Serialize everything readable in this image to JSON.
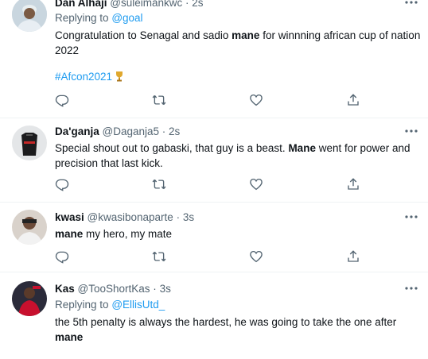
{
  "tweets": [
    {
      "name": "Dan Alhaji",
      "handle": "@suleimankwc",
      "sep": "·",
      "time": "2s",
      "reply_prefix": "Replying to",
      "reply_to": "@goal",
      "text_before": "Congratulation  to Senagal and sadio ",
      "keyword": "mane",
      "text_after": " for winnning african cup of nation 2022",
      "hashtag": "#Afcon2021",
      "emoji": "🏆"
    },
    {
      "name": "Da'ganja",
      "handle": "@Daganja5",
      "sep": "·",
      "time": "2s",
      "text_before": "Special shout out to gabaski, that guy is a beast. ",
      "keyword": "Mane",
      "text_after": " went for power and precision that last kick."
    },
    {
      "name": "kwasi",
      "handle": "@kwasibonaparte",
      "sep": "·",
      "time": "3s",
      "keyword": "mane",
      "text_after": " my hero, my mate"
    },
    {
      "name": "Kas",
      "handle": "@TooShortKas",
      "sep": "·",
      "time": "3s",
      "reply_prefix": "Replying to",
      "reply_to": "@EllisUtd_",
      "text_before": "the 5th penalty is always the hardest, he was going to take the one after ",
      "keyword": "mane"
    }
  ],
  "icons": {
    "reply": "reply-icon",
    "retweet": "retweet-icon",
    "like": "like-icon",
    "share": "share-icon",
    "more": "more-icon"
  },
  "colors": {
    "link": "#1d9bf0",
    "secondary_text": "#536471",
    "primary_text": "#0f1419",
    "divider": "#eff3f4"
  }
}
